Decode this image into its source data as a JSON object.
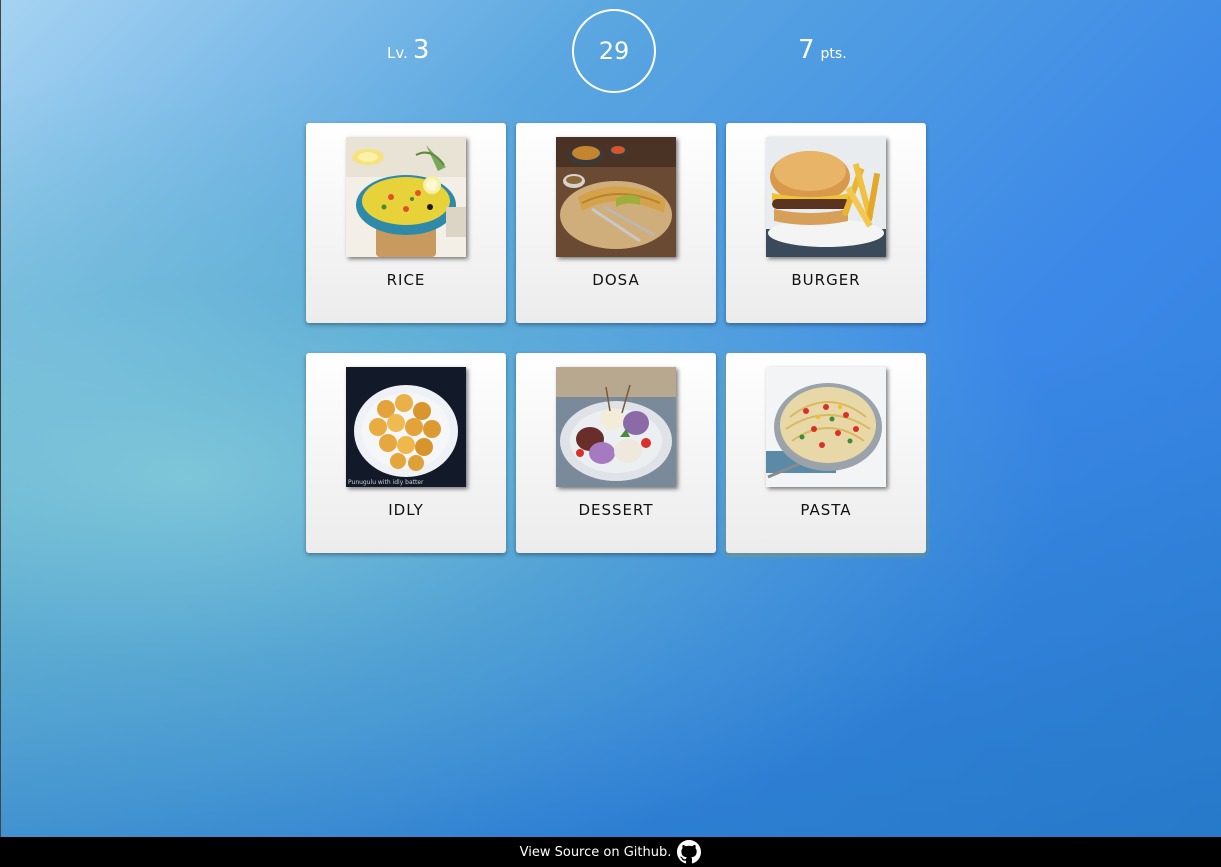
{
  "hud": {
    "level_prefix": "Lv.",
    "level_value": "3",
    "timer": "29",
    "score_value": "7",
    "score_suffix": "pts."
  },
  "cards": [
    {
      "label": "RICE",
      "image": "rice-photo"
    },
    {
      "label": "DOSA",
      "image": "dosa-photo"
    },
    {
      "label": "BURGER",
      "image": "burger-photo"
    },
    {
      "label": "IDLY",
      "image": "idly-photo",
      "caption": "Punugulu with idly batter"
    },
    {
      "label": "DESSERT",
      "image": "dessert-photo"
    },
    {
      "label": "PASTA",
      "image": "pasta-photo"
    }
  ],
  "footer": {
    "link_text": "View Source on Github.",
    "icon": "github-icon"
  },
  "colors": {
    "background_top_left": "#a6d3f2",
    "background_top_right": "#3b88e8",
    "background_bottom": "#2a7fba",
    "card": "#f4f4f4",
    "footer": "#000000"
  }
}
